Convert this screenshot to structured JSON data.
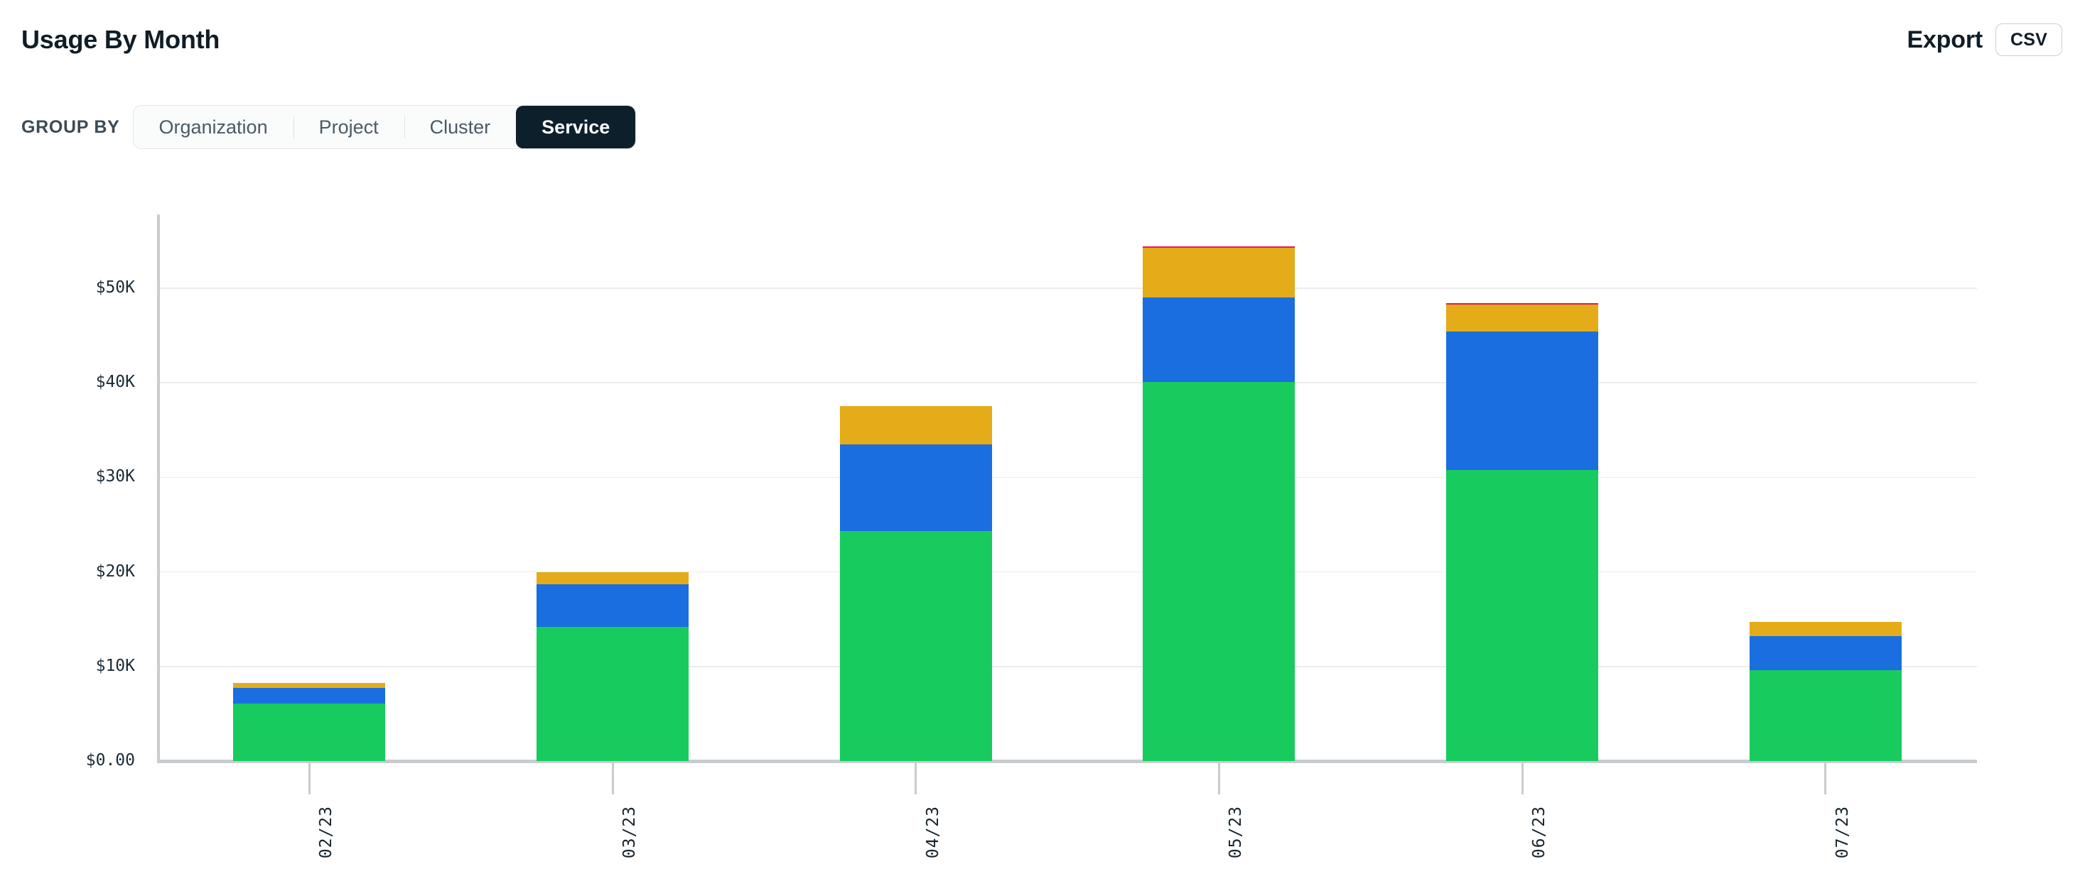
{
  "header": {
    "title": "Usage By Month",
    "export_label": "Export",
    "csv_button": "CSV"
  },
  "controls": {
    "group_by_label": "GROUP BY",
    "options": [
      {
        "label": "Organization",
        "selected": false
      },
      {
        "label": "Project",
        "selected": false
      },
      {
        "label": "Cluster",
        "selected": false
      },
      {
        "label": "Service",
        "selected": true
      }
    ]
  },
  "colors": {
    "green": "#18cb5f",
    "blue": "#1a6ee0",
    "yellow": "#e3ac18",
    "crimson": "#e01c5a",
    "title": "#101d27",
    "active_tab_bg": "#0d1f2b",
    "gridline": "#ececec",
    "axis": "#c8cccf"
  },
  "chart_data": {
    "type": "bar",
    "stacked": true,
    "title": "Usage By Month",
    "xlabel": "",
    "ylabel": "",
    "grid": true,
    "legend": "none",
    "ylim": [
      0,
      57800
    ],
    "ytick_labels": [
      "$50K",
      "$40K",
      "$30K",
      "$20K",
      "$10K",
      "$0.00"
    ],
    "ytick_values": [
      50000,
      40000,
      30000,
      20000,
      10000,
      0
    ],
    "categories": [
      "02/23",
      "03/23",
      "04/23",
      "05/23",
      "06/23",
      "07/23"
    ],
    "series": [
      {
        "name": "green",
        "color": "#18cb5f",
        "values": [
          6100,
          14200,
          24300,
          40100,
          30800,
          9600
        ]
      },
      {
        "name": "blue",
        "color": "#1a6ee0",
        "values": [
          1650,
          4500,
          9200,
          8900,
          14600,
          3600
        ]
      },
      {
        "name": "yellow",
        "color": "#e3ac18",
        "values": [
          520,
          1300,
          4000,
          5300,
          2900,
          1500
        ]
      },
      {
        "name": "crimson",
        "color": "#e01c5a",
        "values": [
          0,
          0,
          0,
          150,
          150,
          0
        ]
      }
    ],
    "totals": [
      8270,
      20000,
      37500,
      54450,
      48450,
      14700
    ]
  }
}
